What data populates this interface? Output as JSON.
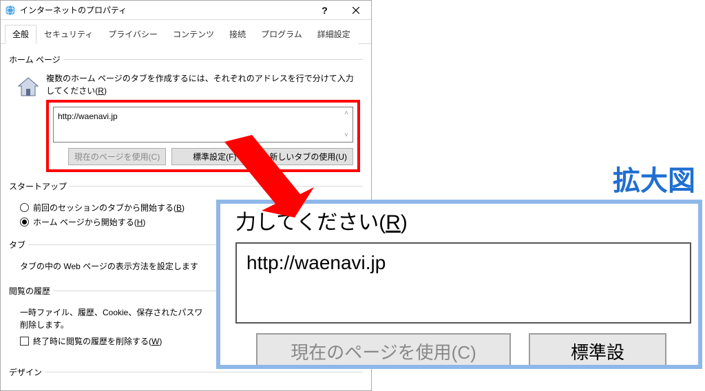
{
  "dialog": {
    "title": "インターネットのプロパティ",
    "help_symbol": "?",
    "tabs": [
      "全般",
      "セキュリティ",
      "プライバシー",
      "コンテンツ",
      "接続",
      "プログラム",
      "詳細設定"
    ],
    "active_tab_index": 0
  },
  "homepage": {
    "legend": "ホーム ページ",
    "instruction_prefix": "複数のホーム ページのタブを作成するには、それぞれのアドレスを行で分けて入力してください(",
    "instruction_access": "R",
    "instruction_suffix": ")",
    "url_value": "http://waenavi.jp",
    "btn_use_current": "現在のページを使用(C)",
    "btn_use_default": "標準設定(F)",
    "btn_use_newtab": "新しいタブの使用(U)"
  },
  "startup": {
    "legend": "スタートアップ",
    "opt_prev_prefix": "前回のセッションのタブから開始する(",
    "opt_prev_access": "B",
    "opt_prev_suffix": ")",
    "opt_home_prefix": "ホーム ページから開始する(",
    "opt_home_access": "H",
    "opt_home_suffix": ")"
  },
  "tabs_section": {
    "legend": "タブ",
    "desc": "タブの中の Web ページの表示方法を設定します"
  },
  "history_section": {
    "legend": "閲覧の履歴",
    "desc": "一時ファイル、履歴、Cookie、保存されたパスワ",
    "desc2": "削除します。",
    "chk_prefix": "終了時に閲覧の履歴を削除する(",
    "chk_access": "W",
    "chk_suffix": ")"
  },
  "design_section": {
    "legend": "デザイン"
  },
  "zoom": {
    "label": "拡大図",
    "line1_prefix": "力してください(",
    "line1_access": "R",
    "line1_suffix": ")",
    "url_value": "http://waenavi.jp",
    "btn_current_partial": "現在のページを使用(C)",
    "btn_default_partial": "標準設"
  }
}
